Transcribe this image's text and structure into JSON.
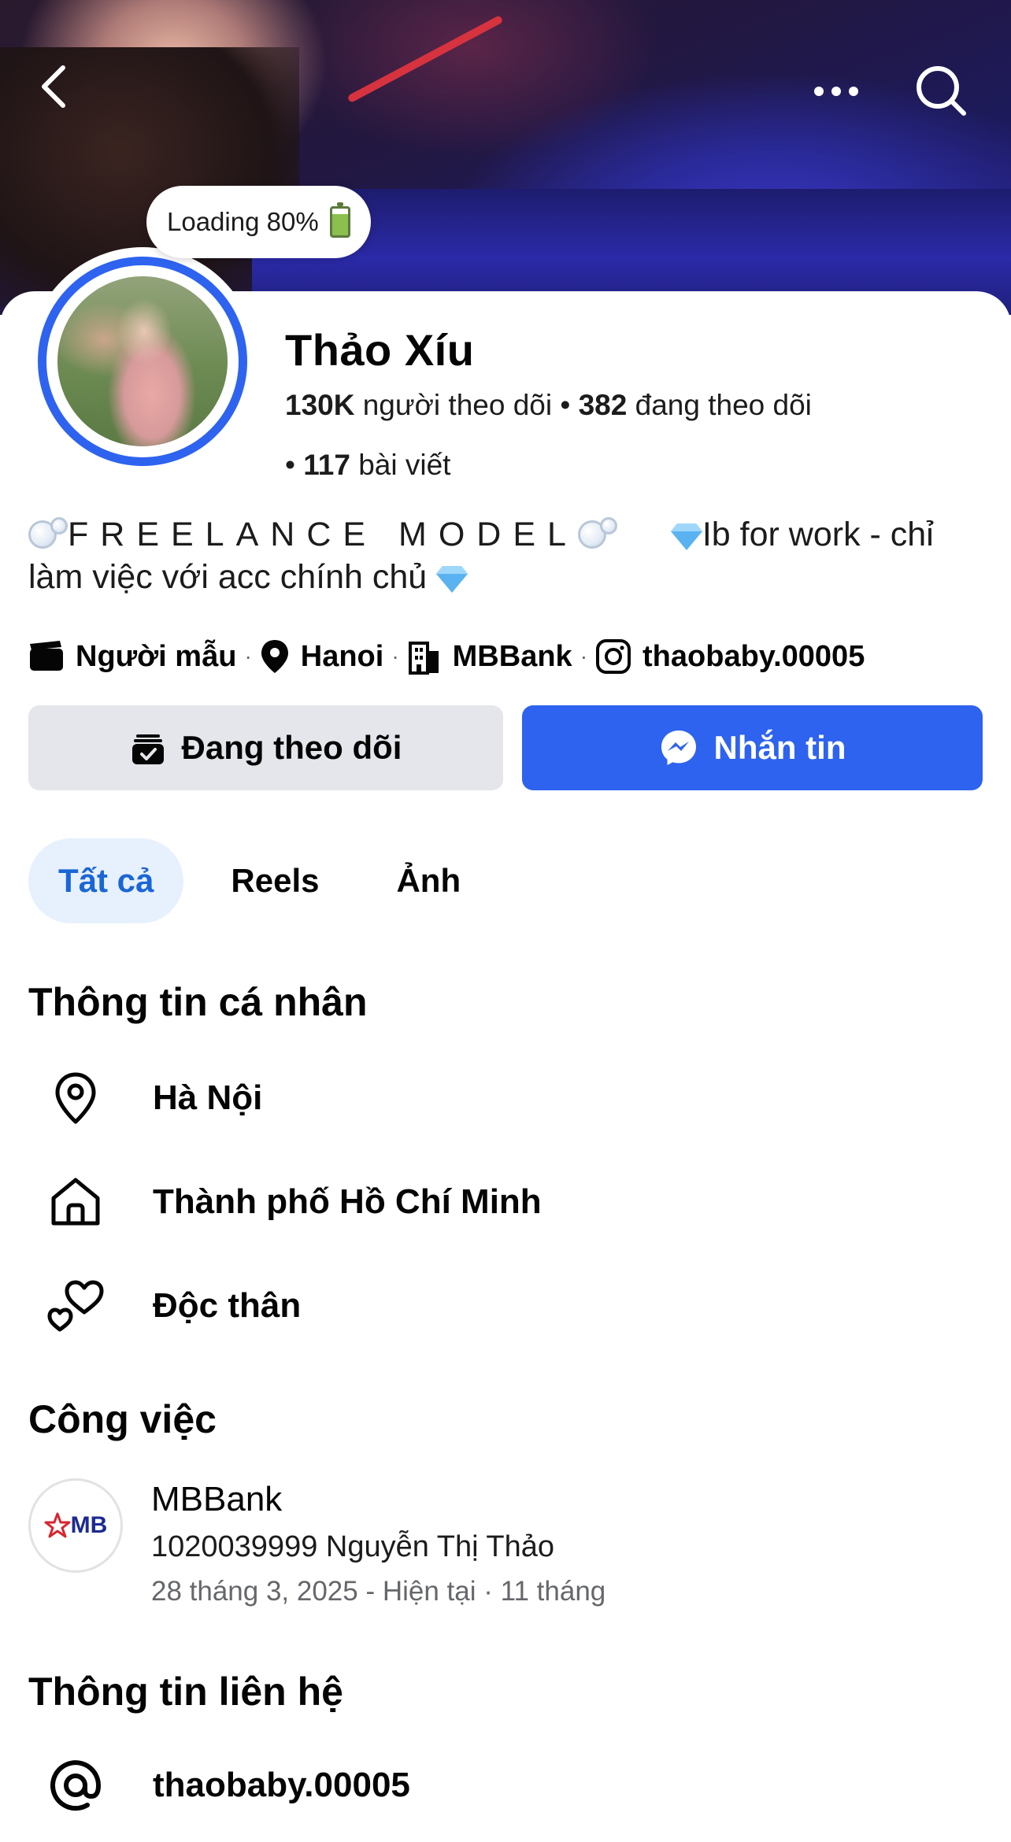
{
  "header": {
    "back_icon": "chevron-left-icon",
    "more_icon": "more-horizontal-icon",
    "search_icon": "search-icon"
  },
  "note": {
    "text": "Loading 80%",
    "emoji": "battery"
  },
  "profile": {
    "name": "Thảo Xíu",
    "followers_count": "130K",
    "followers_label": "người theo dõi",
    "following_count": "382",
    "following_label": "đang theo dõi",
    "posts_count": "117",
    "posts_label": "bài viết",
    "bio_model": "FREELANCE MODEL",
    "bio_rest": "Ib for work - chỉ làm việc với acc chính chủ"
  },
  "details": {
    "category": "Người mẫu",
    "location": "Hanoi",
    "company": "MBBank",
    "instagram": "thaobaby.00005"
  },
  "buttons": {
    "following": "Đang theo dõi",
    "message": "Nhắn tin"
  },
  "tabs": [
    {
      "label": "Tất cả",
      "active": true
    },
    {
      "label": "Reels",
      "active": false
    },
    {
      "label": "Ảnh",
      "active": false
    }
  ],
  "personal_info": {
    "title": "Thông tin cá nhân",
    "current_city": "Hà Nội",
    "hometown": "Thành phố Hồ Chí Minh",
    "relationship": "Độc thân"
  },
  "work": {
    "title": "Công việc",
    "logo_text": "MB",
    "company": "MBBank",
    "position": "1020039999 Nguyễn Thị Thảo",
    "dates": "28 tháng 3, 2025 - Hiện tại · 11 tháng"
  },
  "contact": {
    "title": "Thông tin liên hệ",
    "handle": "thaobaby.00005"
  },
  "colors": {
    "accent_blue": "#2e63ef",
    "tab_active_bg": "#e7f0fd",
    "tab_active_text": "#1a66d6",
    "secondary_button_bg": "#e4e6eb"
  }
}
